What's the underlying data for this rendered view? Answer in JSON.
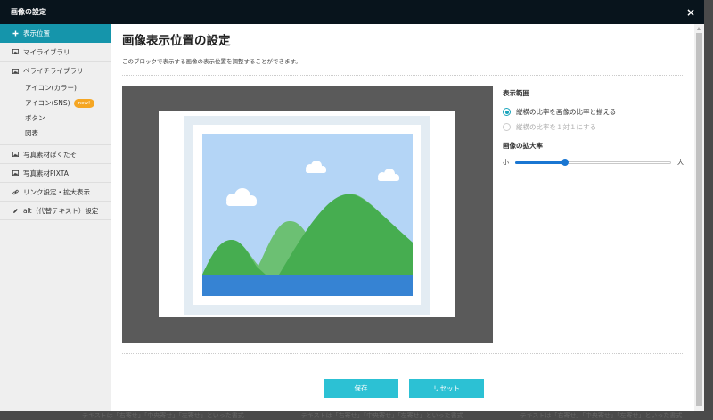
{
  "modal": {
    "title": "画像の設定",
    "close_symbol": "×"
  },
  "sidebar": {
    "items": [
      {
        "label": "表示位置",
        "icon": "plus-icon",
        "active": true
      },
      {
        "label": "マイライブラリ",
        "icon": "image-icon"
      },
      {
        "label": "ペライチライブラリ",
        "icon": "image-icon",
        "children": [
          {
            "label": "アイコン(カラー)"
          },
          {
            "label": "アイコン(SNS)",
            "badge": "new!"
          },
          {
            "label": "ボタン"
          },
          {
            "label": "図表"
          }
        ]
      },
      {
        "label": "写真素材ぱくたそ",
        "icon": "image-icon"
      },
      {
        "label": "写真素材PIXTA",
        "icon": "image-icon"
      },
      {
        "label": "リンク設定・拡大表示",
        "icon": "link-icon"
      },
      {
        "label": "alt（代替テキスト）設定",
        "icon": "pencil-icon"
      }
    ]
  },
  "main": {
    "heading": "画像表示位置の設定",
    "description": "このブロックで表示する画像の表示位置を調整することができます。",
    "display_range": {
      "title": "表示範囲",
      "options": [
        {
          "label": "縦横の比率を画像の比率と揃える",
          "checked": true,
          "disabled": false
        },
        {
          "label": "縦横の比率を１対１にする",
          "checked": false,
          "disabled": true
        }
      ]
    },
    "zoom": {
      "title": "画像の拡大率",
      "min_label": "小",
      "max_label": "大",
      "value": 0.32
    },
    "buttons": {
      "save": "保存",
      "reset": "リセット"
    }
  },
  "background_text": [
    "テキストは「右寄せ」「中央寄せ」「左寄せ」といった書式",
    "テキストは「右寄せ」「中央寄せ」「左寄せ」といった書式",
    "テキストは「右寄せ」「中央寄せ」「左寄せ」といった書式"
  ],
  "colors": {
    "title_bar": "#08141c",
    "sidebar_active": "#1595ab",
    "button": "#2cc1d4",
    "radio": "#1aa4bc",
    "slider": "#1976d2",
    "badge": "#f5a623"
  }
}
